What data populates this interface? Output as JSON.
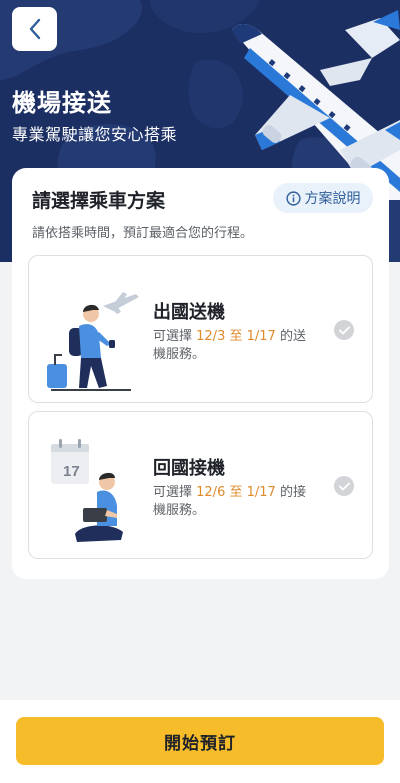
{
  "header": {
    "back_icon": "chevron-left-icon",
    "title": "機場接送",
    "subtitle": "專業駕駛讓您安心搭乘",
    "hero_illustration": "airplane-over-world-map",
    "background_color": "#1c2f63"
  },
  "panel": {
    "title": "請選擇乘車方案",
    "info_icon": "info-circle-icon",
    "info_label": "方案說明",
    "hint": "請依搭乘時間，預訂最適合您的行程。"
  },
  "options": [
    {
      "title": "出國送機",
      "illustration": "traveler-with-suitcase",
      "desc_prefix": "可選擇 ",
      "date_from": "12/3",
      "date_sep": " 至 ",
      "date_to": "1/17",
      "desc_suffix": " 的送機服務。",
      "selected": false
    },
    {
      "title": "回國接機",
      "illustration": "calendar-person-laptop",
      "calendar_day": "17",
      "desc_prefix": "可選擇 ",
      "date_from": "12/6",
      "date_sep": " 至 ",
      "date_to": "1/17",
      "desc_suffix": " 的接機服務。",
      "selected": false
    }
  ],
  "footer": {
    "cta_label": "開始預訂"
  },
  "colors": {
    "accent": "#f6bc2a",
    "date_highlight": "#e08a2c",
    "link": "#2e5f9a",
    "navy": "#1c2f63"
  }
}
